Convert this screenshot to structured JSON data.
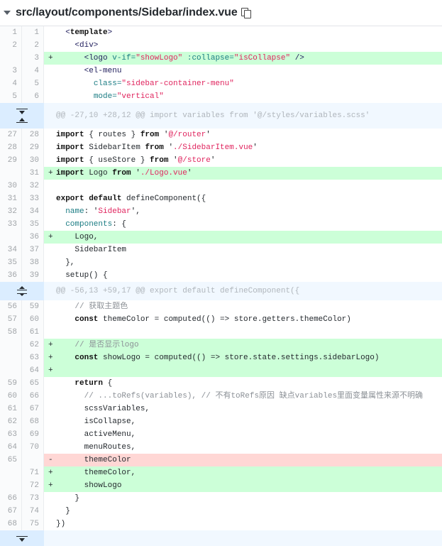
{
  "file": {
    "path": "src/layout/components/Sidebar/index.vue"
  },
  "blocks": [
    {
      "kind": "lines",
      "rows": [
        {
          "o": "1",
          "n": "1",
          "type": "ctx",
          "tok": [
            [
              "",
              "  "
            ],
            [
              "t",
              "<"
            ],
            [
              "k",
              "template"
            ],
            [
              "t",
              ">"
            ]
          ]
        },
        {
          "o": "2",
          "n": "2",
          "type": "ctx",
          "tok": [
            [
              "",
              "    "
            ],
            [
              "t",
              "<div>"
            ]
          ]
        },
        {
          "o": "",
          "n": "3",
          "type": "add",
          "tok": [
            [
              "",
              "      "
            ],
            [
              "t",
              "<logo "
            ],
            [
              "a",
              "v-if="
            ],
            [
              "s",
              "\"showLogo\""
            ],
            [
              "a",
              " :collapse="
            ],
            [
              "s",
              "\"isCollapse\""
            ],
            [
              "t",
              " />"
            ]
          ]
        },
        {
          "o": "3",
          "n": "4",
          "type": "ctx",
          "tok": [
            [
              "",
              "      "
            ],
            [
              "t",
              "<el-menu"
            ]
          ]
        },
        {
          "o": "4",
          "n": "5",
          "type": "ctx",
          "tok": [
            [
              "",
              "        "
            ],
            [
              "a",
              "class="
            ],
            [
              "s",
              "\"sidebar-container-menu\""
            ]
          ]
        },
        {
          "o": "5",
          "n": "6",
          "type": "ctx",
          "tok": [
            [
              "",
              "        "
            ],
            [
              "a",
              "mode="
            ],
            [
              "s",
              "\"vertical\""
            ]
          ]
        }
      ]
    },
    {
      "kind": "hunk",
      "style": "updown",
      "text": "@@ -27,10 +28,12 @@ import variables from '@/styles/variables.scss'"
    },
    {
      "kind": "lines",
      "rows": [
        {
          "o": "27",
          "n": "28",
          "type": "ctx",
          "tok": [
            [
              "k",
              "import"
            ],
            [
              "",
              " { routes } "
            ],
            [
              "k",
              "from"
            ],
            [
              "",
              " '"
            ],
            [
              "s",
              "@/router"
            ],
            [
              "",
              "'"
            ]
          ]
        },
        {
          "o": "28",
          "n": "29",
          "type": "ctx",
          "tok": [
            [
              "k",
              "import"
            ],
            [
              "",
              " SidebarItem "
            ],
            [
              "k",
              "from"
            ],
            [
              "",
              " '"
            ],
            [
              "s",
              "./SidebarItem.vue"
            ],
            [
              "",
              "'"
            ]
          ]
        },
        {
          "o": "29",
          "n": "30",
          "type": "ctx",
          "tok": [
            [
              "k",
              "import"
            ],
            [
              "",
              " { useStore } "
            ],
            [
              "k",
              "from"
            ],
            [
              "",
              " '"
            ],
            [
              "s",
              "@/store"
            ],
            [
              "",
              "'"
            ]
          ]
        },
        {
          "o": "",
          "n": "31",
          "type": "add",
          "tok": [
            [
              "k",
              "import"
            ],
            [
              "",
              " Logo "
            ],
            [
              "k",
              "from"
            ],
            [
              "",
              " '"
            ],
            [
              "s",
              "./Logo.vue"
            ],
            [
              "",
              "'"
            ]
          ]
        },
        {
          "o": "30",
          "n": "32",
          "type": "ctx",
          "tok": []
        },
        {
          "o": "31",
          "n": "33",
          "type": "ctx",
          "tok": [
            [
              "k",
              "export default"
            ],
            [
              "",
              " defineComponent({"
            ]
          ]
        },
        {
          "o": "32",
          "n": "34",
          "type": "ctx",
          "tok": [
            [
              "",
              "  "
            ],
            [
              "p",
              "name"
            ],
            [
              "",
              ": '"
            ],
            [
              "s",
              "Sidebar"
            ],
            [
              "",
              "',"
            ]
          ]
        },
        {
          "o": "33",
          "n": "35",
          "type": "ctx",
          "tok": [
            [
              "",
              "  "
            ],
            [
              "p",
              "components"
            ],
            [
              "",
              ": {"
            ]
          ]
        },
        {
          "o": "",
          "n": "36",
          "type": "add",
          "tok": [
            [
              "",
              "    Logo,"
            ]
          ]
        },
        {
          "o": "34",
          "n": "37",
          "type": "ctx",
          "tok": [
            [
              "",
              "    SidebarItem"
            ]
          ]
        },
        {
          "o": "35",
          "n": "38",
          "type": "ctx",
          "tok": [
            [
              "",
              "  },"
            ]
          ]
        },
        {
          "o": "36",
          "n": "39",
          "type": "ctx",
          "tok": [
            [
              "",
              "  setup() {"
            ]
          ]
        }
      ]
    },
    {
      "kind": "hunk",
      "style": "both",
      "text": "@@ -56,13 +59,17 @@ export default defineComponent({"
    },
    {
      "kind": "lines",
      "rows": [
        {
          "o": "56",
          "n": "59",
          "type": "ctx",
          "tok": [
            [
              "",
              "    "
            ],
            [
              "c",
              "// 获取主题色"
            ]
          ]
        },
        {
          "o": "57",
          "n": "60",
          "type": "ctx",
          "tok": [
            [
              "",
              "    "
            ],
            [
              "k",
              "const"
            ],
            [
              "",
              " themeColor = computed(() => store.getters.themeColor)"
            ]
          ]
        },
        {
          "o": "58",
          "n": "61",
          "type": "ctx",
          "tok": []
        },
        {
          "o": "",
          "n": "62",
          "type": "add",
          "tok": [
            [
              "",
              "    "
            ],
            [
              "c",
              "// 是否显示logo"
            ]
          ]
        },
        {
          "o": "",
          "n": "63",
          "type": "add",
          "tok": [
            [
              "",
              "    "
            ],
            [
              "k",
              "const"
            ],
            [
              "",
              " showLogo = computed(() => store.state.settings.sidebarLogo)"
            ]
          ]
        },
        {
          "o": "",
          "n": "64",
          "type": "add",
          "tok": []
        },
        {
          "o": "59",
          "n": "65",
          "type": "ctx",
          "tok": [
            [
              "",
              "    "
            ],
            [
              "k",
              "return"
            ],
            [
              "",
              " {"
            ]
          ]
        },
        {
          "o": "60",
          "n": "66",
          "type": "ctx",
          "tok": [
            [
              "",
              "      "
            ],
            [
              "c",
              "// ...toRefs(variables), // 不有toRefs原因 缺点variables里面变量属性来源不明确"
            ]
          ]
        },
        {
          "o": "61",
          "n": "67",
          "type": "ctx",
          "tok": [
            [
              "",
              "      scssVariables,"
            ]
          ]
        },
        {
          "o": "62",
          "n": "68",
          "type": "ctx",
          "tok": [
            [
              "",
              "      isCollapse,"
            ]
          ]
        },
        {
          "o": "63",
          "n": "69",
          "type": "ctx",
          "tok": [
            [
              "",
              "      activeMenu,"
            ]
          ]
        },
        {
          "o": "64",
          "n": "70",
          "type": "ctx",
          "tok": [
            [
              "",
              "      menuRoutes,"
            ]
          ]
        },
        {
          "o": "65",
          "n": "",
          "type": "del",
          "tok": [
            [
              "",
              "      themeColor"
            ]
          ]
        },
        {
          "o": "",
          "n": "71",
          "type": "add",
          "tok": [
            [
              "",
              "      themeColor,"
            ]
          ]
        },
        {
          "o": "",
          "n": "72",
          "type": "add",
          "tok": [
            [
              "",
              "      showLogo"
            ]
          ]
        },
        {
          "o": "66",
          "n": "73",
          "type": "ctx",
          "tok": [
            [
              "",
              "    }"
            ]
          ]
        },
        {
          "o": "67",
          "n": "74",
          "type": "ctx",
          "tok": [
            [
              "",
              "  }"
            ]
          ]
        },
        {
          "o": "68",
          "n": "75",
          "type": "ctx",
          "tok": [
            [
              "",
              "})"
            ]
          ]
        }
      ]
    },
    {
      "kind": "hunk",
      "style": "down",
      "text": ""
    }
  ]
}
